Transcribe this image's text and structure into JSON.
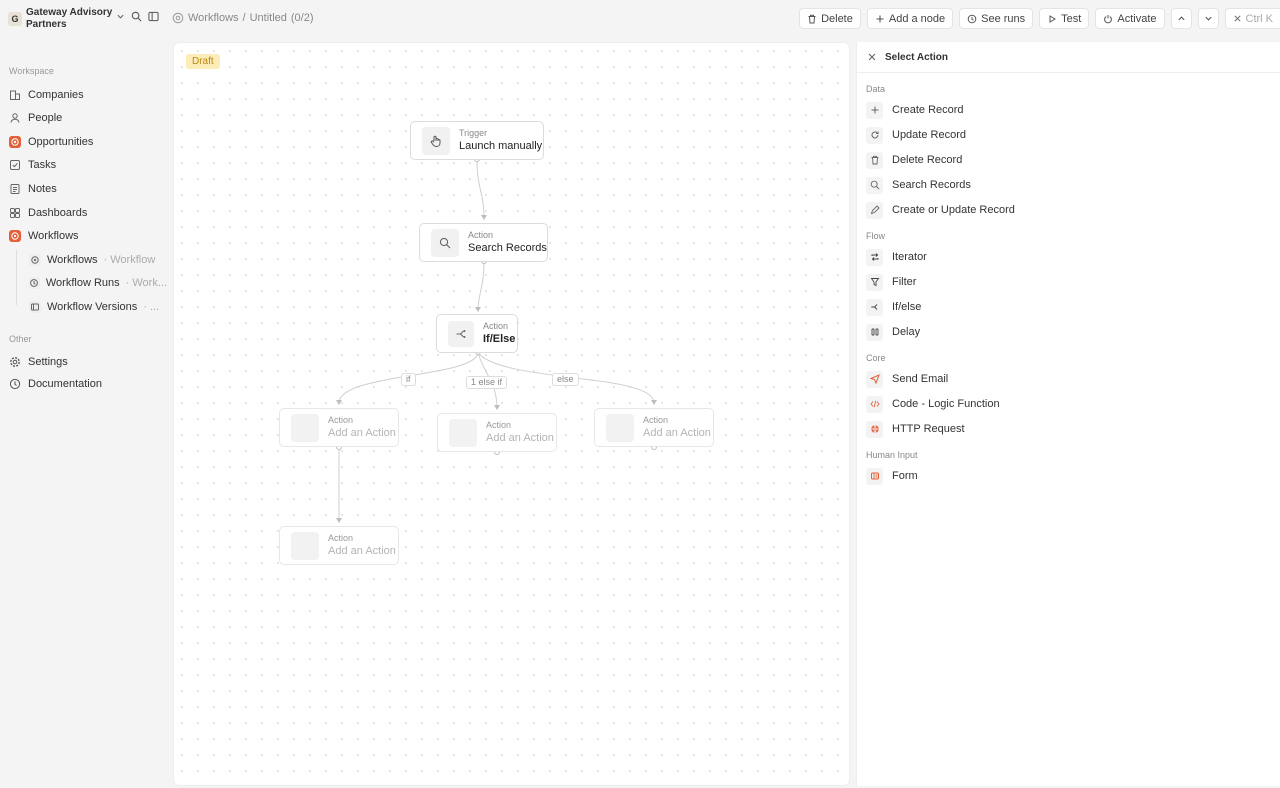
{
  "workspace": {
    "logo": "G",
    "name": "Gateway Advisory Partners"
  },
  "breadcrumb": {
    "root": "Workflows",
    "sep": "/",
    "title": "Untitled",
    "count": "(0/2)"
  },
  "toolbar": {
    "delete": "Delete",
    "add_node": "Add a node",
    "see_runs": "See runs",
    "test": "Test",
    "activate": "Activate",
    "shortcut": "Ctrl K"
  },
  "sidebar": {
    "workspace_label": "Workspace",
    "items": [
      {
        "label": "Companies",
        "icon": "building-icon"
      },
      {
        "label": "People",
        "icon": "user-icon"
      },
      {
        "label": "Opportunities",
        "icon": "target-icon"
      },
      {
        "label": "Tasks",
        "icon": "checkbox-icon"
      },
      {
        "label": "Notes",
        "icon": "note-icon"
      },
      {
        "label": "Dashboards",
        "icon": "dashboard-icon"
      },
      {
        "label": "Workflows",
        "icon": "workflow-icon"
      }
    ],
    "subitems": [
      {
        "label": "Workflows",
        "muted": "· Workflow"
      },
      {
        "label": "Workflow Runs",
        "muted": "· Work..."
      },
      {
        "label": "Workflow Versions",
        "muted": "· ..."
      }
    ],
    "other_label": "Other",
    "other_items": [
      {
        "label": "Settings",
        "icon": "gear-icon"
      },
      {
        "label": "Documentation",
        "icon": "help-icon"
      }
    ]
  },
  "canvas": {
    "badge": "Draft",
    "nodes": {
      "trigger": {
        "type": "Trigger",
        "label": "Launch manually"
      },
      "search": {
        "type": "Action",
        "label": "Search Records"
      },
      "ifelse": {
        "type": "Action",
        "label": "If/Else"
      },
      "branch1": {
        "type": "Action",
        "label": "Add an Action"
      },
      "branch2": {
        "type": "Action",
        "label": "Add an Action"
      },
      "branch3": {
        "type": "Action",
        "label": "Add an Action"
      },
      "branch4": {
        "type": "Action",
        "label": "Add an Action"
      }
    },
    "edge_labels": {
      "if": "if",
      "elseif": "1 else if",
      "else": "else"
    }
  },
  "panel": {
    "title": "Select Action",
    "categories": {
      "data": "Data",
      "flow": "Flow",
      "core": "Core",
      "human": "Human Input"
    },
    "actions": {
      "create_record": "Create Record",
      "update_record": "Update Record",
      "delete_record": "Delete Record",
      "search_records": "Search Records",
      "upsert_record": "Create or Update Record",
      "iterator": "Iterator",
      "filter": "Filter",
      "ifelse": "If/else",
      "delay": "Delay",
      "send_email": "Send Email",
      "code": "Code - Logic Function",
      "http": "HTTP Request",
      "form": "Form"
    }
  },
  "colors": {
    "accent": "#e2613a",
    "draft_bg": "#fcecb8",
    "draft_text": "#b98a10"
  }
}
